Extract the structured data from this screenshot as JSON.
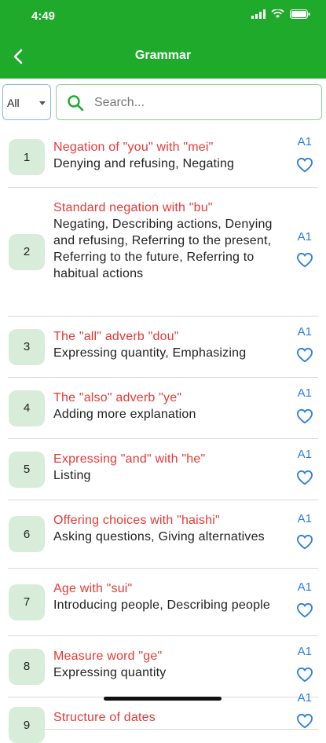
{
  "status": {
    "time": "4:49"
  },
  "header": {
    "title": "Grammar"
  },
  "filter": {
    "selected": "All"
  },
  "search": {
    "placeholder": "Search..."
  },
  "items": [
    {
      "num": "1",
      "title": "Negation of \"you\" with \"mei\"",
      "desc": "Denying and refusing,  Negating",
      "level": "A1"
    },
    {
      "num": "2",
      "title": "Standard negation with \"bu\"",
      "desc": "Negating,  Describing actions,  Denying and refusing,  Referring to the present,  Referring to the future,  Referring to habitual actions",
      "level": "A1"
    },
    {
      "num": "3",
      "title": "The \"all\" adverb \"dou\"",
      "desc": "Expressing quantity,  Emphasizing",
      "level": "A1"
    },
    {
      "num": "4",
      "title": "The \"also\" adverb \"ye\"",
      "desc": "Adding more explanation",
      "level": "A1"
    },
    {
      "num": "5",
      "title": "Expressing \"and\" with \"he\"",
      "desc": "Listing",
      "level": "A1"
    },
    {
      "num": "6",
      "title": "Offering choices with \"haishi\"",
      "desc": "Asking questions,  Giving alternatives",
      "level": "A1"
    },
    {
      "num": "7",
      "title": "Age with \"sui\"",
      "desc": "Introducing people,  Describing people",
      "level": "A1"
    },
    {
      "num": "8",
      "title": "Measure word \"ge\"",
      "desc": "Expressing quantity",
      "level": "A1"
    },
    {
      "num": "9",
      "title": "Structure of dates",
      "desc": "",
      "level": "A1"
    }
  ]
}
